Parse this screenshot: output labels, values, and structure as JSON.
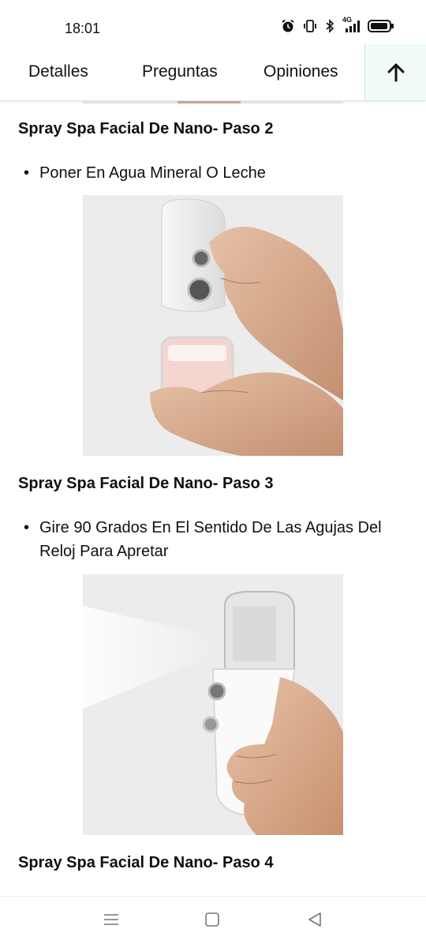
{
  "status_bar": {
    "time": "18:01",
    "network_label": "4G",
    "icons": [
      "alarm-icon",
      "vibrate-icon",
      "bluetooth-icon",
      "signal-icon",
      "battery-icon"
    ]
  },
  "tabs": [
    {
      "label": "Detalles"
    },
    {
      "label": "Preguntas"
    },
    {
      "label": "Opiniones"
    }
  ],
  "back_to_top_icon": "arrow-up-icon",
  "content": {
    "step2_title": "Spray Spa Facial De Nano- Paso 2",
    "step2_bullet": "Poner En Agua Mineral O Leche",
    "step3_title": "Spray Spa Facial De Nano- Paso 3",
    "step3_bullet": "Gire 90 Grados En El Sentido De Las Agujas Del Reloj Para Apretar",
    "step4_title": "Spray Spa Facial De Nano- Paso 4"
  },
  "nav_bar": {
    "icons": [
      "menu-icon",
      "home-icon",
      "back-icon"
    ]
  },
  "colors": {
    "text": "#0f1111",
    "back_to_top_bg": "#f0fbf9",
    "image_bg": "#ebebeb"
  }
}
